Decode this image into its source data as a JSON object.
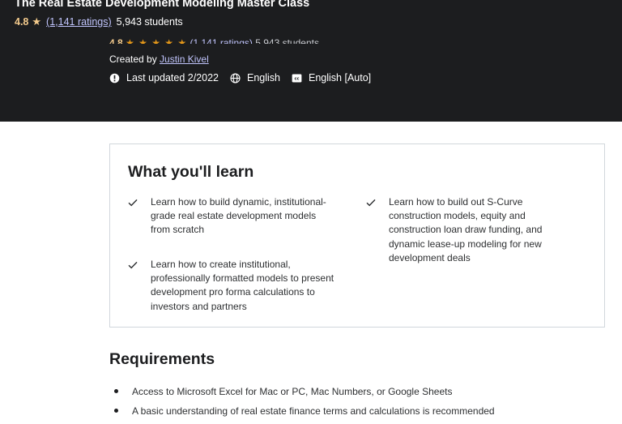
{
  "course": {
    "title": "The Real Estate Development Modeling Master Class",
    "rating": "4.8",
    "ratings_count": "(1,141 ratings)",
    "students": "5,943 students",
    "stars": "★ ★ ★ ★ ★",
    "created_by_label": "Created by",
    "author": "Justin Kivel",
    "last_updated": "Last updated 2/2022",
    "language": "English",
    "captions": "English [Auto]"
  },
  "icons": {
    "star": "star-icon",
    "alert": "alert-icon",
    "globe": "globe-icon",
    "captions": "closed-captions-icon",
    "check": "check-icon"
  },
  "learn": {
    "title": "What you'll learn",
    "items": [
      "Learn how to build dynamic, institutional-grade real estate development models from scratch",
      "Learn how to build out S-Curve construction models, equity and construction loan draw funding, and dynamic lease-up modeling for new development deals",
      "Learn how to create institutional, professionally formatted models to present development pro forma calculations to investors and partners"
    ]
  },
  "requirements": {
    "title": "Requirements",
    "items": [
      "Access to Microsoft Excel for Mac or PC, Mac Numbers, or Google Sheets",
      "A basic understanding of real estate finance terms and calculations is recommended"
    ]
  },
  "colors": {
    "header_bg": "#1c1d1f",
    "rating": "#f3ca8c",
    "link_on_dark": "#c0c4fc",
    "border": "#d1d7dc"
  }
}
